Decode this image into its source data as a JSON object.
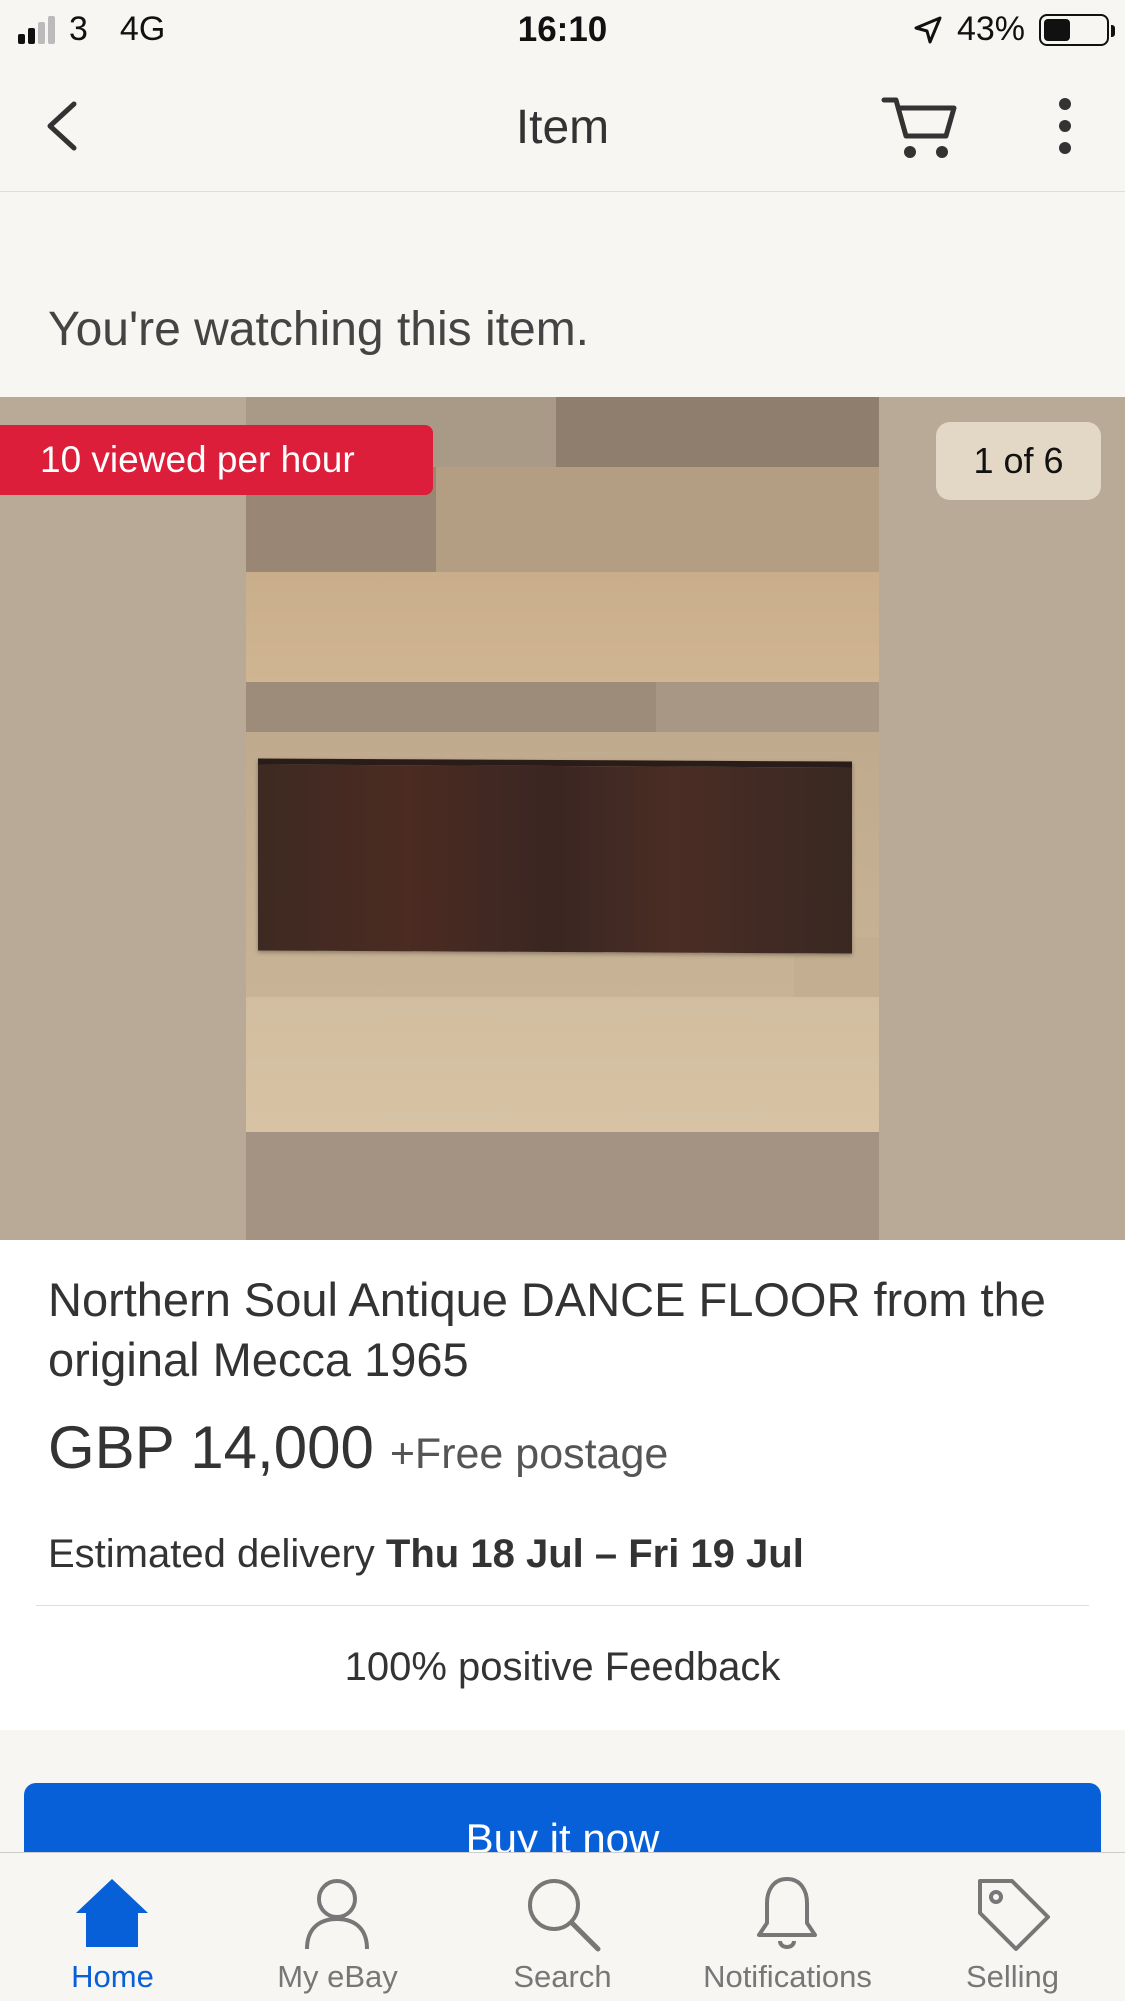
{
  "status_bar": {
    "carrier": "3",
    "network": "4G",
    "time": "16:10",
    "battery": "43%",
    "battery_level": 0.43
  },
  "nav": {
    "title": "Item",
    "back_icon": "chevron-left-icon",
    "cart_icon": "cart-icon",
    "more_icon": "more-vertical-icon"
  },
  "watch_banner": {
    "text": "You're watching this item."
  },
  "gallery": {
    "viewed_badge": "10 viewed per hour",
    "counter": "1 of 6",
    "badge_color": "#dc1e3a"
  },
  "item": {
    "title": "Northern Soul Antique DANCE FLOOR from the original Mecca 1965",
    "price": "GBP 14,000",
    "postage": "+Free postage",
    "delivery_label": "Estimated delivery",
    "delivery_dates": "Thu 18 Jul – Fri 19 Jul",
    "feedback": "100% positive Feedback"
  },
  "actions": {
    "buy_now": "Buy it now",
    "accent_color": "#0860d8"
  },
  "tab_bar": {
    "tabs": [
      {
        "label": "Home",
        "icon": "home-icon",
        "active": true
      },
      {
        "label": "My eBay",
        "icon": "user-icon",
        "active": false
      },
      {
        "label": "Search",
        "icon": "search-icon",
        "active": false
      },
      {
        "label": "Notifications",
        "icon": "bell-icon",
        "active": false
      },
      {
        "label": "Selling",
        "icon": "tag-icon",
        "active": false
      }
    ]
  }
}
